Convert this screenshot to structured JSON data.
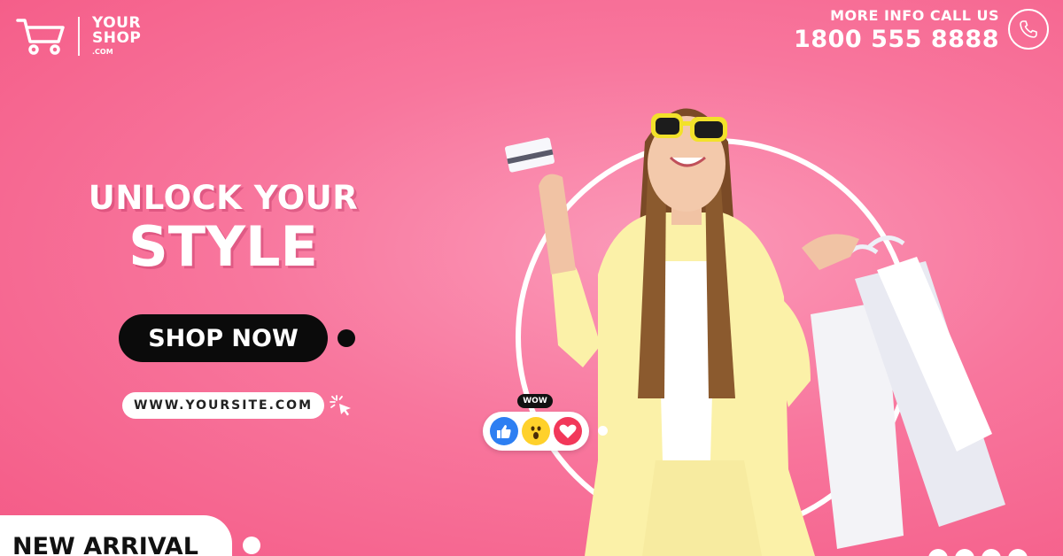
{
  "brand": {
    "line1": "YOUR",
    "line2": "SHOP",
    "line3": ".COM"
  },
  "contact": {
    "label": "MORE INFO CALL US",
    "number": "1800 555 8888"
  },
  "headline": {
    "line1": "UNLOCK YOUR",
    "line2": "STYLE"
  },
  "cta": {
    "label": "SHOP NOW"
  },
  "website": {
    "text": "WWW.YOURSITE.COM"
  },
  "badge": {
    "label": "NEW ARRIVAL"
  },
  "reactions": {
    "tag": "WOW",
    "items": [
      "like-icon",
      "wow-icon",
      "love-icon"
    ]
  },
  "colors": {
    "background": "#f8769d",
    "accent_dark": "#0b0b0b",
    "text_light": "#ffffff",
    "like": "#2d7ff2",
    "wow": "#ffd12b",
    "love": "#f2385a"
  }
}
